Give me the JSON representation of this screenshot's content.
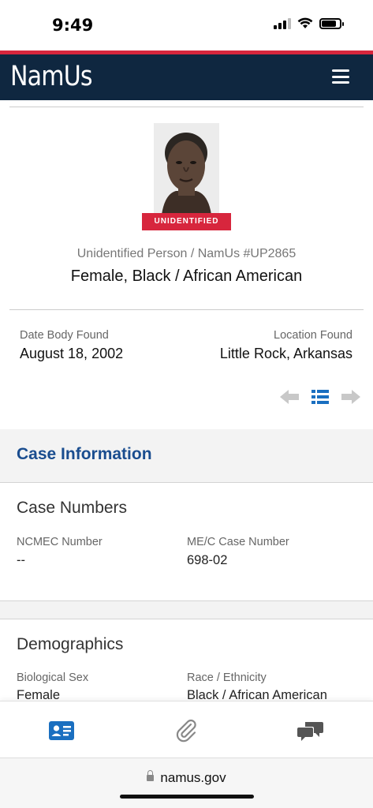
{
  "status_bar": {
    "time": "9:49"
  },
  "header": {
    "logo": "NamUs",
    "menu_icon": "hamburger-menu-icon"
  },
  "summary": {
    "status_badge": "UNIDENTIFIED",
    "case_id": "Unidentified Person / NamUs #UP2865",
    "headline": "Female, Black / African American",
    "date_body_found_label": "Date Body Found",
    "date_body_found": "August 18, 2002",
    "location_found_label": "Location Found",
    "location_found": "Little Rock, Arkansas"
  },
  "section": {
    "title": "Case Information"
  },
  "case_numbers": {
    "title": "Case Numbers",
    "ncmec_label": "NCMEC Number",
    "ncmec_value": "--",
    "mec_label": "ME/C Case Number",
    "mec_value": "698-02"
  },
  "demographics": {
    "title": "Demographics",
    "sex_label": "Biological Sex",
    "sex_value": "Female",
    "race_label": "Race / Ethnicity",
    "race_value": "Black / African American"
  },
  "tab_bar": {
    "tabs": [
      "case-info-icon",
      "attachments-icon",
      "chat-icon"
    ]
  },
  "url_bar": {
    "url": "namus.gov"
  },
  "colors": {
    "accent": "#1a4d8f",
    "brand_red": "#d7263d",
    "header_bg": "#0f2740"
  }
}
